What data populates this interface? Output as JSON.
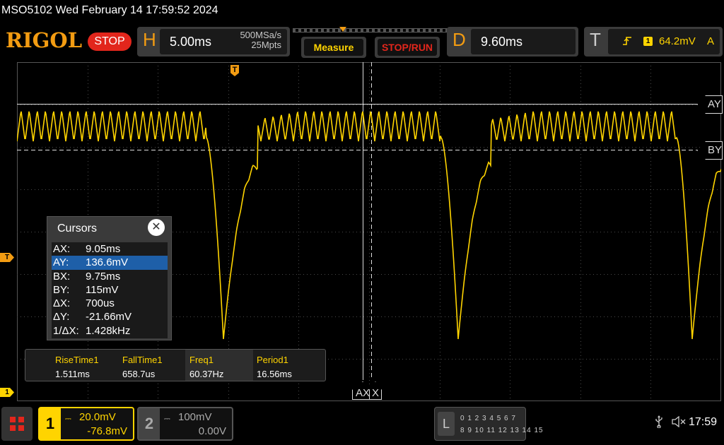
{
  "header": {
    "device_title": "MSO5102  Wed February 14 17:59:52 2024",
    "logo": "RIGOL",
    "run_state": "STOP",
    "horizontal": {
      "letter": "H",
      "timebase": "5.00ms",
      "sample_rate": "500MSa/s",
      "memory_depth": "25Mpts"
    },
    "measure_label": "Measure",
    "stop_run_label": "STOP/RUN",
    "delay": {
      "letter": "D",
      "value": "9.60ms"
    },
    "trigger": {
      "letter": "T",
      "edge_icon": "rising-edge-icon",
      "source": "1",
      "level": "64.2mV",
      "mode": "A"
    }
  },
  "markers": {
    "trigger_position": "T",
    "trigger_level": "T",
    "ch1": "1"
  },
  "cursor_tags": {
    "ay": "AY",
    "by": "BY",
    "ax": "AX",
    "bx": "X"
  },
  "cursors_dialog": {
    "title": "Cursors",
    "close_icon": "close-icon",
    "rows": [
      {
        "key": "AX:",
        "value": "9.05ms"
      },
      {
        "key": "AY:",
        "value": "136.6mV"
      },
      {
        "key": "BX:",
        "value": "9.75ms"
      },
      {
        "key": "BY:",
        "value": "115mV"
      },
      {
        "key": "ΔX:",
        "value": "700us"
      },
      {
        "key": "ΔY:",
        "value": "-21.66mV"
      },
      {
        "key": "1/ΔX:",
        "value": "1.428kHz"
      }
    ],
    "selected_index": 1
  },
  "measurements": [
    {
      "label": "RiseTime1",
      "value": "1.511ms"
    },
    {
      "label": "FallTime1",
      "value": "658.7us"
    },
    {
      "label": "Freq1",
      "value": "60.37Hz"
    },
    {
      "label": "Period1",
      "value": "16.56ms"
    }
  ],
  "channels": {
    "ch1": {
      "number": "1",
      "coupling": "DC",
      "scale": "20.0mV",
      "offset": "-76.8mV"
    },
    "ch2": {
      "number": "2",
      "coupling": "DC",
      "scale": "100mV",
      "offset": "0.00V"
    }
  },
  "logic": {
    "label": "L",
    "row1": "0 1 2 3  4 5 6 7",
    "row2": "8 9 10 11  12 13 14 15"
  },
  "status": {
    "usb_icon": "usb-icon",
    "speaker_icon": "speaker-muted-icon",
    "clock": "17:59"
  },
  "colors": {
    "ch1": "#ffd400",
    "accent": "#f39c12",
    "stop": "#e2261c",
    "selection": "#1e5fa8"
  }
}
